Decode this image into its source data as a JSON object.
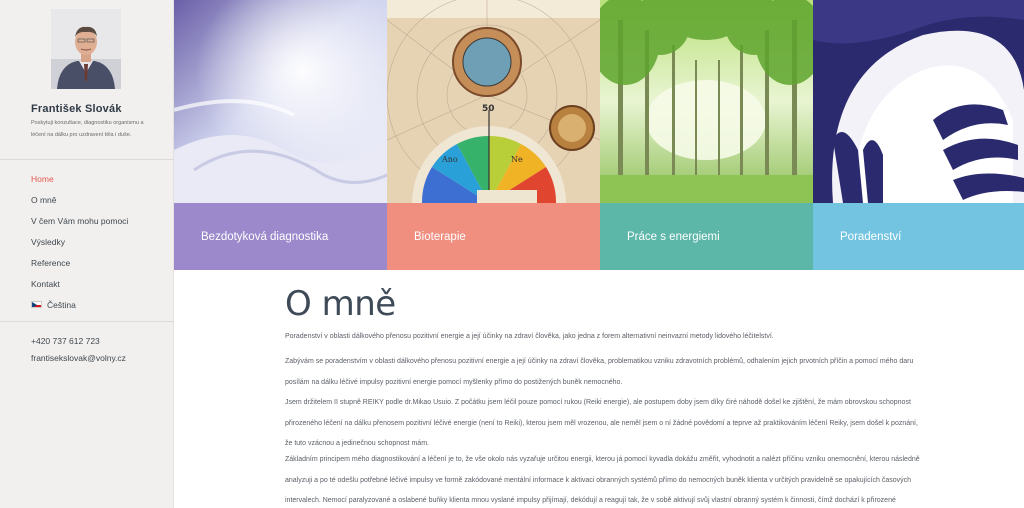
{
  "profile": {
    "name": "František Slovák",
    "description": "Poskytuji konzultace, diagnostiku organismu a léčení na dálku pro uzdravení těla i duše."
  },
  "nav": {
    "items": [
      {
        "label": "Home",
        "active": true
      },
      {
        "label": "O mně",
        "active": false
      },
      {
        "label": "V čem Vám mohu pomoci",
        "active": false
      },
      {
        "label": "Výsledky",
        "active": false
      },
      {
        "label": "Reference",
        "active": false
      },
      {
        "label": "Kontakt",
        "active": false
      },
      {
        "label": "Čeština",
        "active": false,
        "icon": "czech-flag-icon"
      }
    ]
  },
  "contact": {
    "phone": "+420 737 612 723",
    "email": "frantisekslovak@volny.cz"
  },
  "tiles": [
    {
      "label": "Bezdotyková diagnostika",
      "color": "#9b89cc"
    },
    {
      "label": "Bioterapie",
      "color": "#f08e80"
    },
    {
      "label": "Práce s energiemi",
      "color": "#5cb7a9"
    },
    {
      "label": "Poradenství",
      "color": "#73c4e0"
    }
  ],
  "dial": {
    "number_50": "50",
    "word_left": "Ano",
    "word_right": "Ne"
  },
  "main": {
    "title": "O mně",
    "paragraphs": [
      "Poradenství v oblasti dálkového přenosu pozitivní energie a její účinky na zdraví člověka, jako jedna z forem alternativní neinvazní metody lidového léčitelství.",
      "Zabývám se poradenstvím v oblasti dálkového přenosu pozitivní energie a její účinky na zdraví člověka, problematikou vzniku zdravotních problémů, odhalením jejich prvotních příčin a pomocí mého daru posílám na dálku léčivé impulsy pozitivní energie pomocí myšlenky přímo do postižených buněk nemocného.",
      "Jsem držitelem II stupně REIKY podle dr.Mikao Usuio. Z počátku jsem léčil pouze pomocí rukou (Reiki energie), ale postupem doby jsem díky čiré náhodě došel ke zjištění, že mám obrovskou schopnost přirozeného léčení na dálku přenosem pozitivní léčivé energie (není to Reiki), kterou jsem měl vrozenou, ale neměl jsem o ní žádné povědomí a teprve až praktikováním léčení Reiky, jsem došel k poznání, že tuto vzácnou a jedinečnou schopnost mám.",
      "Základním principem mého diagnostikování a léčení je to, že vše okolo nás vyzařuje určitou energii, kterou já pomocí kyvadla dokážu změřit, vyhodnotit a nalézt příčinu vzniku onemocnění, kterou následně analyzuji a po té odešlu potřebné léčivé impulsy ve formě zakódované mentální informace k aktivaci obranných systémů přímo do nemocných buněk klienta v určitých pravidelně se opakujících časových intervalech. Nemocí paralyzované a oslabené buňky klienta mnou vyslané impulsy přijímají, dekódují a reagují tak, že v sobě aktivují svůj vlastní obranný systém k činnosti, čímž dochází k přirozené „samoobraně“ (uzdravováním jednotlivých buněk), která se postupně přenáší i na všechny další okolní postižené buňky. Díky"
    ]
  }
}
